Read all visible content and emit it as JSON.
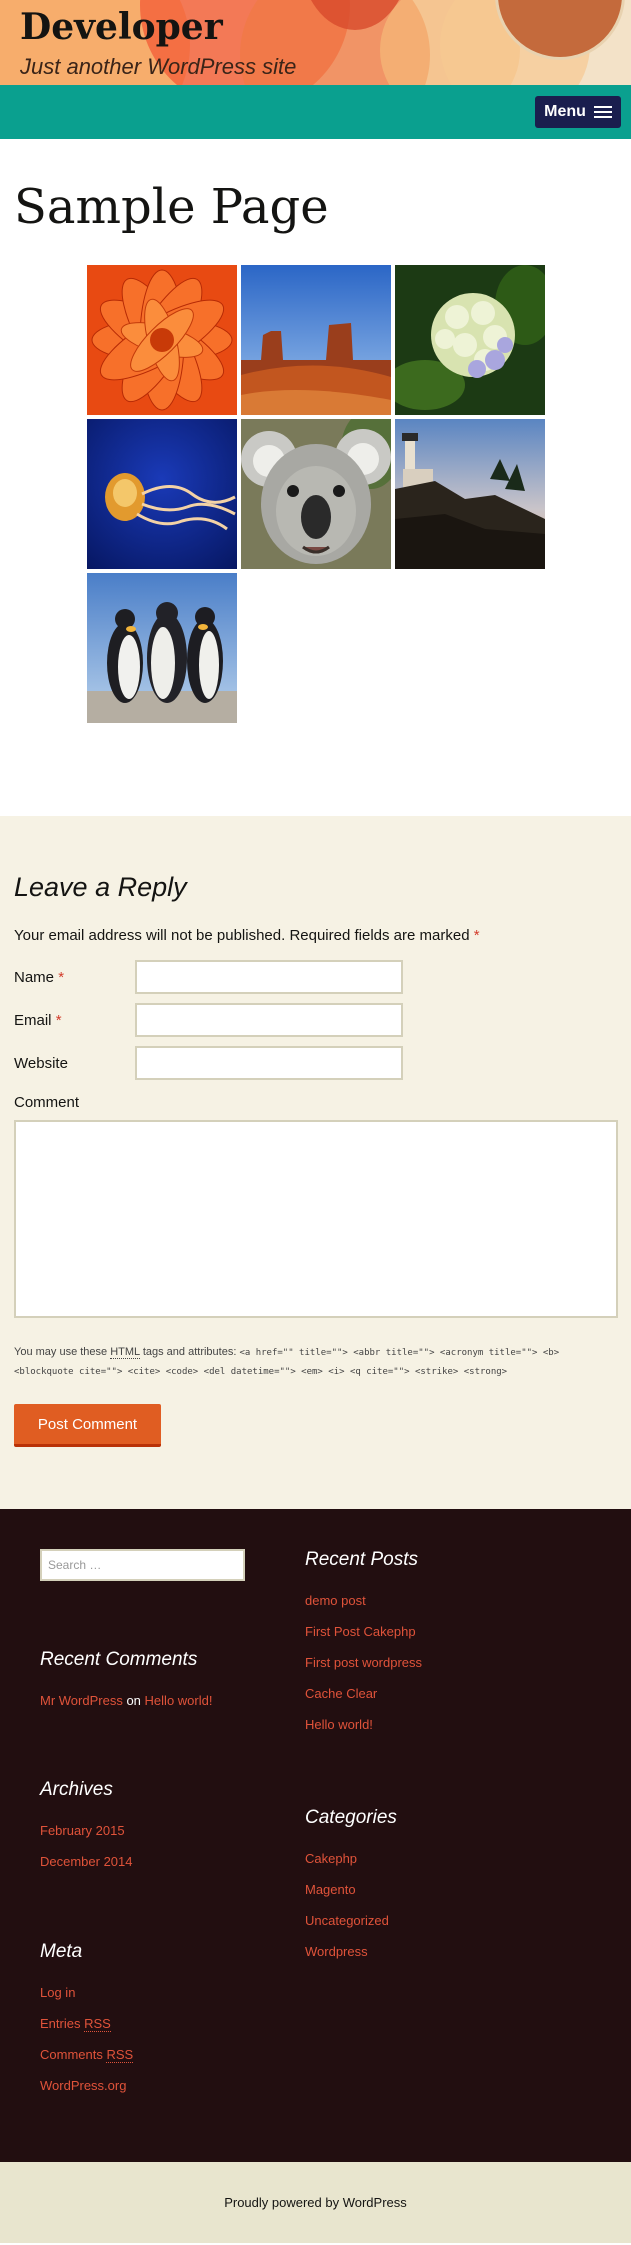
{
  "header": {
    "site_title": "Developer",
    "site_description": "Just another WordPress site"
  },
  "nav": {
    "menu_label": "Menu"
  },
  "page": {
    "title": "Sample Page"
  },
  "gallery": [
    "Chrysanthemum",
    "Desert",
    "Hydrangeas",
    "Jellyfish",
    "Koala",
    "Lighthouse",
    "Penguins"
  ],
  "reply": {
    "title": "Leave a Reply",
    "notes": "Your email address will not be published. Required fields are marked",
    "required_mark": "*",
    "name_label": "Name",
    "email_label": "Email",
    "website_label": "Website",
    "comment_label": "Comment",
    "allowed_prefix": "You may use these",
    "allowed_abbr": "HTML",
    "allowed_suffix": "tags and attributes:",
    "allowed_tags_line1": "<a href=\"\" title=\"\"> <abbr title=\"\"> <acronym title=\"\"> <b>",
    "allowed_tags_line2": "<blockquote cite=\"\"> <cite> <code> <del datetime=\"\"> <em> <i> <q cite=\"\"> <strike> <strong>",
    "submit_label": "Post Comment"
  },
  "widgets": {
    "search_placeholder": "Search …",
    "recent_posts_title": "Recent Posts",
    "recent_posts": [
      "demo post",
      "First Post Cakephp",
      "First post wordpress",
      "Cache Clear",
      "Hello world!"
    ],
    "recent_comments_title": "Recent Comments",
    "recent_comment_author": "Mr WordPress",
    "recent_comment_on": "on",
    "recent_comment_post": "Hello world!",
    "archives_title": "Archives",
    "archives": [
      "February 2015",
      "December 2014"
    ],
    "categories_title": "Categories",
    "categories": [
      "Cakephp",
      "Magento",
      "Uncategorized",
      "Wordpress"
    ],
    "meta_title": "Meta",
    "meta_login": "Log in",
    "meta_entries_prefix": "Entries",
    "meta_comments_prefix": "Comments",
    "meta_rss": "RSS",
    "meta_wporg": "WordPress.org"
  },
  "footer": {
    "powered_by": "Proudly powered by WordPress"
  },
  "colors": {
    "accent": "#e05d22",
    "nav": "#0aa08f",
    "footer_bg": "#220e10",
    "link": "#e0533a"
  }
}
